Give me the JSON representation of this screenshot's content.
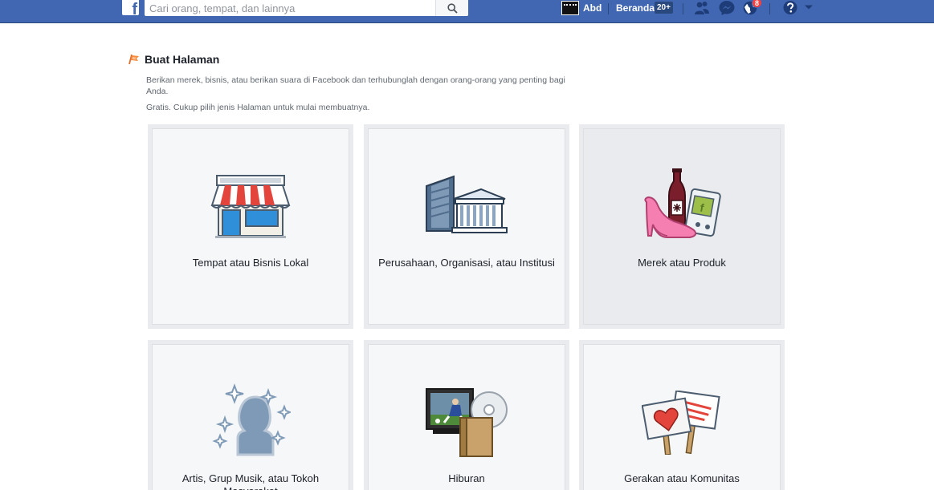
{
  "topbar": {
    "logo_letter": "f",
    "search_placeholder": "Cari orang, tempat, dan lainnya",
    "user_name": "Abd",
    "home_label": "Beranda",
    "home_count": "20+",
    "notifications_count": "8"
  },
  "header": {
    "title": "Buat Halaman",
    "description": "Berikan merek, bisnis, atau berikan suara di Facebook dan terhubunglah dengan orang-orang yang penting bagi Anda.",
    "subdescription": "Gratis. Cukup pilih jenis Halaman untuk mulai membuatnya."
  },
  "categories": [
    {
      "label": "Tempat atau Bisnis Lokal",
      "icon": "storefront-icon"
    },
    {
      "label": "Perusahaan, Organisasi, atau Institusi",
      "icon": "company-buildings-icon"
    },
    {
      "label": "Merek atau Produk",
      "icon": "brand-products-icon"
    },
    {
      "label": "Artis, Grup Musik, atau Tokoh Masyarakat",
      "icon": "artist-silhouette-icon"
    },
    {
      "label": "Hiburan",
      "icon": "entertainment-icon"
    },
    {
      "label": "Gerakan atau Komunitas",
      "icon": "community-signs-icon"
    }
  ],
  "colors": {
    "topbar": "#4267b2",
    "card_background": "#f6f7f9",
    "card_hover": "#e9ebee",
    "badge": "#fa3e3e"
  }
}
